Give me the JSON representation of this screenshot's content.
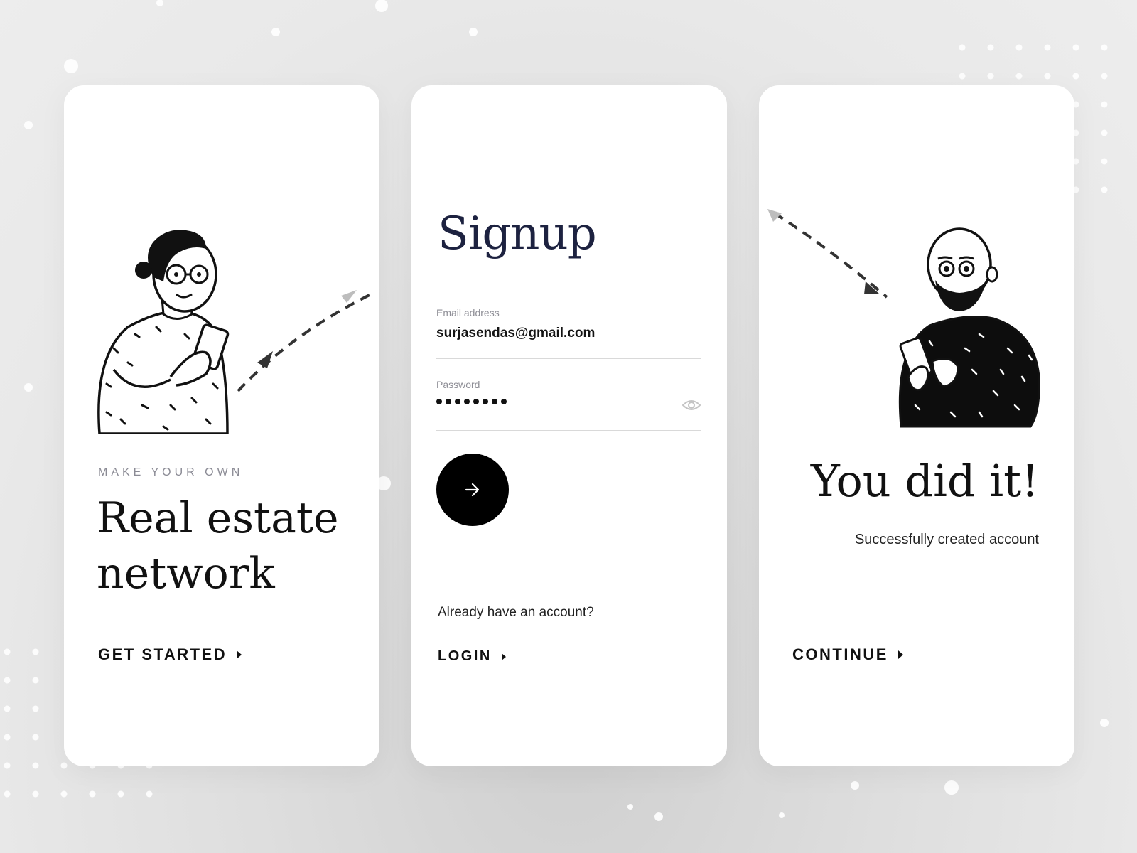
{
  "onboarding": {
    "eyebrow": "MAKE YOUR OWN",
    "title_line1": "Real estate",
    "title_line2": "network",
    "cta_label": "GET STARTED"
  },
  "signup": {
    "title": "Signup",
    "email_label": "Email address",
    "email_value": "surjasendas@gmail.com",
    "password_label": "Password",
    "password_mask_length": 8,
    "already_text": "Already have an account?",
    "login_label": "LOGIN"
  },
  "success": {
    "title": "You did it!",
    "subtitle": "Successfully created account",
    "cta_label": "CONTINUE"
  },
  "icons": {
    "next": "arrow-right-icon",
    "show_password": "eye-icon",
    "cta_chevron": "caret-right-icon"
  },
  "colors": {
    "background": "#e6e6e6",
    "card": "#ffffff",
    "signup_title": "#1d2240",
    "button": "#000000",
    "muted_label": "#8b8b95"
  }
}
